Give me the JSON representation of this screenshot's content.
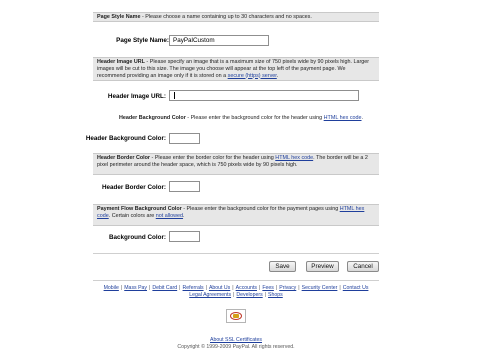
{
  "page_style": {
    "heading": "Page Style Name",
    "note": " - Please choose a name containing up to 30 characters and no spaces.",
    "label": "Page Style Name:",
    "value": "PayPalCustom"
  },
  "header_image": {
    "heading": "Header Image URL",
    "note": " - Please specify an image that is a maximum size of 750 pixels wide by 90 pixels high. Larger images will be cut to this size. The image you choose will appear at the top left of the payment page. We recommend providing an image only if it is stored on a ",
    "link": "secure (https) server",
    "note_end": ".",
    "label": "Header Image URL:",
    "value": ""
  },
  "header_bg": {
    "heading": "Header Background Color",
    "note": " - Please enter the background color for the header using ",
    "link": "HTML hex code",
    "note_end": ".",
    "label": "Header Background Color:",
    "value": ""
  },
  "header_border": {
    "heading": "Header Border Color",
    "note": " - Please enter the border color for the header using ",
    "link": "HTML hex code",
    "note_end": ". The border will be a 2 pixel perimeter around the header space, which is 750 pixels wide by 90 pixels high.",
    "label": "Header Border Color:",
    "value": ""
  },
  "payment_flow": {
    "heading": "Payment Flow Background Color",
    "note": " - Please enter the background color for the payment pages using ",
    "link": "HTML hex code",
    "note_mid": ". Certain colors are ",
    "link2": "not allowed",
    "note_end": ".",
    "label": "Background Color:",
    "value": ""
  },
  "buttons": {
    "save": "Save",
    "preview": "Preview",
    "cancel": "Cancel"
  },
  "footer": {
    "row1": [
      "Mobile",
      "Mass Pay",
      "Debit Card",
      "Referrals",
      "About Us",
      "Accounts",
      "Fees",
      "Privacy",
      "Security Center",
      "Contact Us"
    ],
    "row2": [
      "Legal Agreements",
      "Developers",
      "Shops"
    ],
    "ssl_link": "About SSL Certificates",
    "copyright": "Copyright © 1999-2009 PayPal. All rights reserved."
  },
  "colors": {
    "band": "#e7e7e7",
    "link": "#1f3f9c"
  }
}
